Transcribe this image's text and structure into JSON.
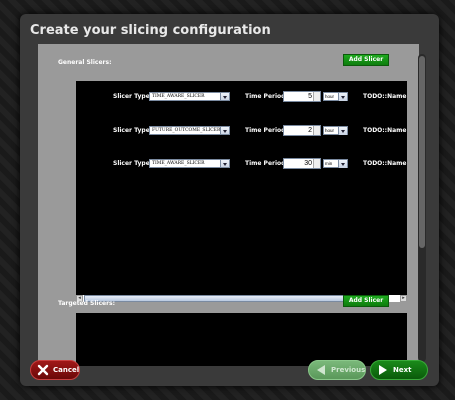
{
  "dialog": {
    "title": "Create your slicing configuration"
  },
  "general": {
    "label": "General Slicers:",
    "add_button": "Add Slicer",
    "rows": [
      {
        "type_label": "Slicer Type:",
        "type_value": "TIME_AWARE_SLICER",
        "period_label": "Time Period:",
        "period_value": "5",
        "unit": "hour",
        "name": "TODO::Name"
      },
      {
        "type_label": "Slicer Type:",
        "type_value": "FUTURE_OUTCOME_SLICER",
        "period_label": "Time Period:",
        "period_value": "2",
        "unit": "hour",
        "name": "TODO::Name"
      },
      {
        "type_label": "Slicer Type:",
        "type_value": "TIME_AWARE_SLICER",
        "period_label": "Time Period:",
        "period_value": "30",
        "unit": "min",
        "name": "TODO::Name"
      }
    ]
  },
  "targeted": {
    "label": "Targeted Slicers:",
    "add_button": "Add Slicer"
  },
  "footer": {
    "cancel": "Cancel",
    "previous": "Previous",
    "next": "Next"
  }
}
